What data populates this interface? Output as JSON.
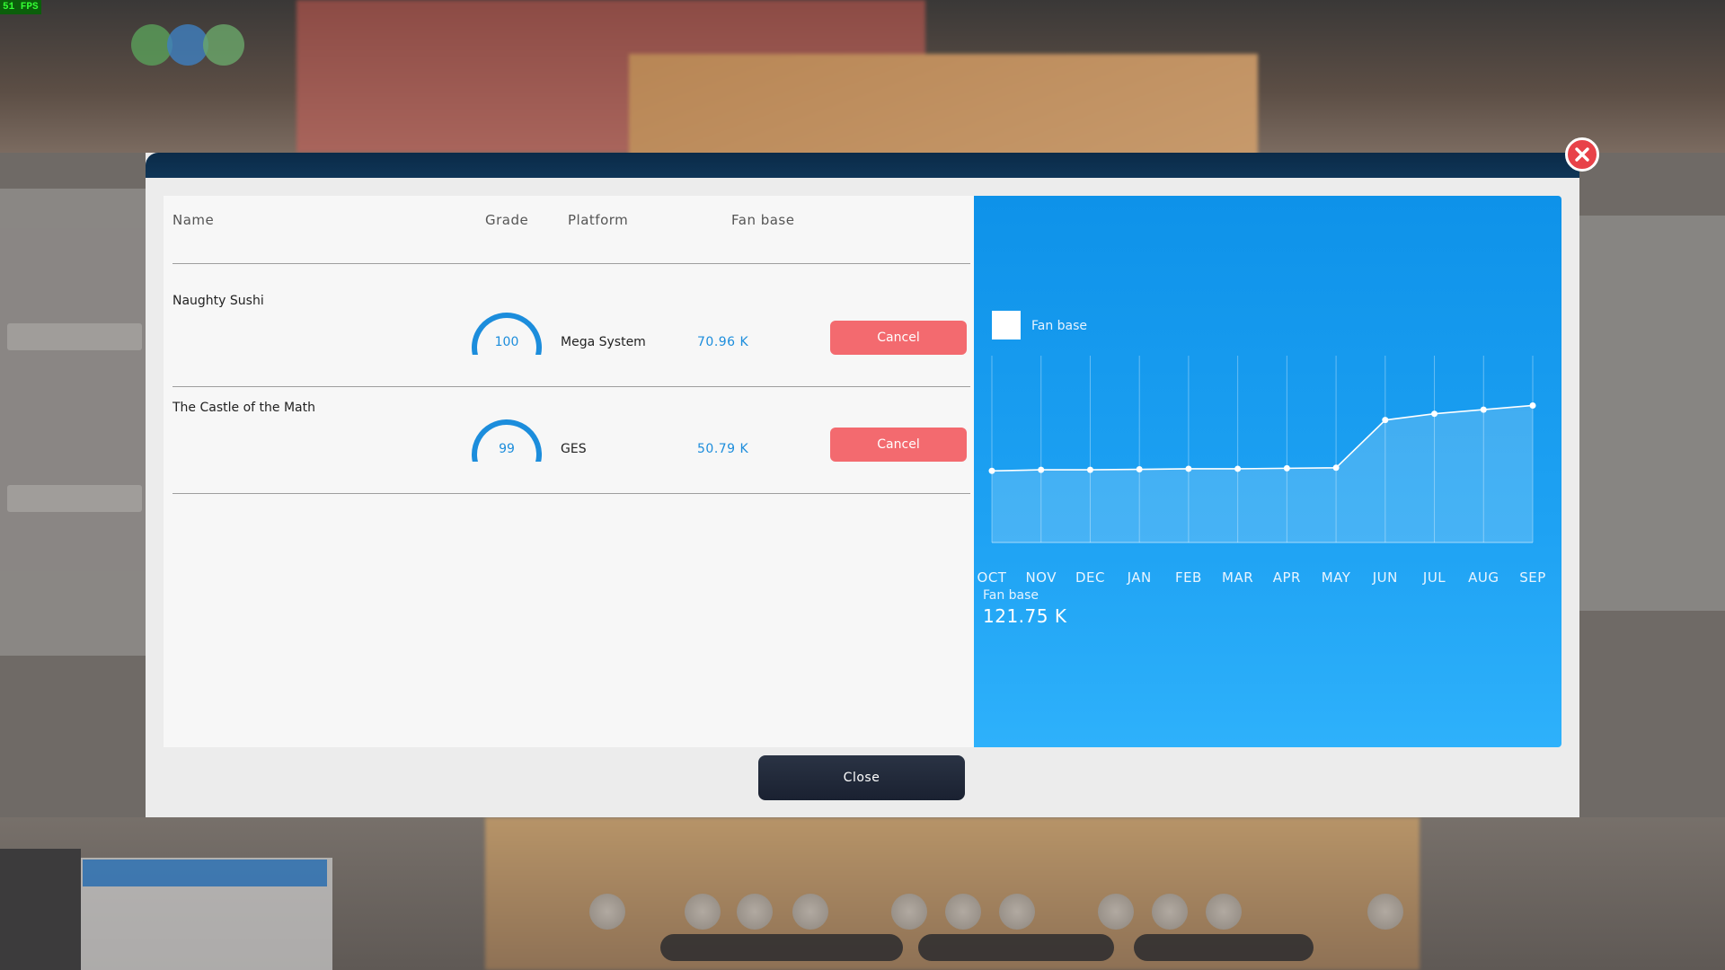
{
  "overlay": {
    "fps": "51 FPS"
  },
  "dialog": {
    "columns": {
      "name": "Name",
      "grade": "Grade",
      "platform": "Platform",
      "fan_base": "Fan base"
    },
    "rows": [
      {
        "name": "Naughty Sushi",
        "grade": "100",
        "grade_level": 1.0,
        "platform": "Mega System",
        "fan_base": "70.96 K",
        "action": "Cancel"
      },
      {
        "name": "The Castle of the Math",
        "grade": "99",
        "grade_level": 0.99,
        "platform": "GES",
        "fan_base": "50.79 K",
        "action": "Cancel"
      }
    ],
    "close_label": "Close"
  },
  "chart": {
    "legend": "Fan base",
    "stat_label": "Fan base",
    "stat_value": "121.75 K",
    "colors": {
      "panel": "#1a9cf0",
      "line": "#ffffff",
      "cancel": "#f36a6f",
      "accent": "#1c8ddc"
    }
  },
  "chart_data": {
    "type": "area",
    "categories": [
      "OCT",
      "NOV",
      "DEC",
      "JAN",
      "FEB",
      "MAR",
      "APR",
      "MAY",
      "JUN",
      "JUL",
      "AUG",
      "SEP"
    ],
    "series": [
      {
        "name": "Fan base",
        "values": [
          69,
          70,
          70,
          70.5,
          71,
          71,
          71.5,
          72,
          118,
          124,
          128,
          132
        ]
      }
    ],
    "ylim": [
      0,
      180
    ],
    "grid": "vertical"
  }
}
